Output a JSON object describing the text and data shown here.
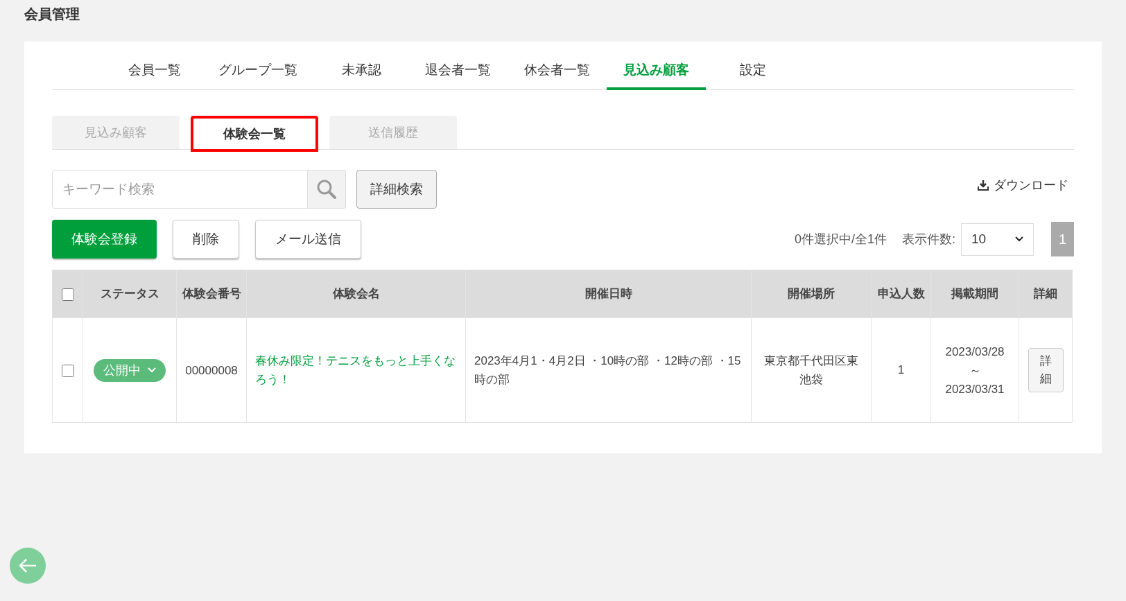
{
  "page_title": "会員管理",
  "tabs": [
    {
      "label": "会員一覧",
      "selected": false
    },
    {
      "label": "グループ一覧",
      "selected": false
    },
    {
      "label": "未承認",
      "selected": false
    },
    {
      "label": "退会者一覧",
      "selected": false
    },
    {
      "label": "休会者一覧",
      "selected": false
    },
    {
      "label": "見込み顧客",
      "selected": true
    },
    {
      "label": "設定",
      "selected": false
    }
  ],
  "sub_tabs": [
    {
      "label": "見込み顧客",
      "selected": false
    },
    {
      "label": "体験会一覧",
      "selected": true
    },
    {
      "label": "送信履歴",
      "selected": false
    }
  ],
  "search": {
    "placeholder": "キーワード検索",
    "detail_button": "詳細検索"
  },
  "download": "ダウンロード",
  "actions": [
    {
      "label": "体験会登録",
      "kind": "primary"
    },
    {
      "label": "削除",
      "kind": "default"
    },
    {
      "label": "メール送信",
      "kind": "default"
    }
  ],
  "selection_count": "0件選択中/全1件",
  "page_size": {
    "label": "表示件数:",
    "value": "10"
  },
  "pages": [
    {
      "label": "1",
      "selected": true
    }
  ],
  "table": {
    "select_all_checked": false,
    "columns": [
      "ステータス",
      "体験会番号",
      "体験会名",
      "開催日時",
      "開催場所",
      "申込人数",
      "掲載期間",
      "詳細"
    ],
    "rows": [
      {
        "checked": false,
        "status": "公開中",
        "number": "00000008",
        "name": "春休み限定！テニスをもっと上手くなろう！",
        "datetime": "2023年4月1・4月2日 ・10時の部 ・12時の部 ・15時の部",
        "place": "東京都千代田区東池袋",
        "applicants": "1",
        "period_start": "2023/03/28",
        "period_separator": "～",
        "period_end": "2023/03/31",
        "detail": "詳細"
      }
    ]
  }
}
